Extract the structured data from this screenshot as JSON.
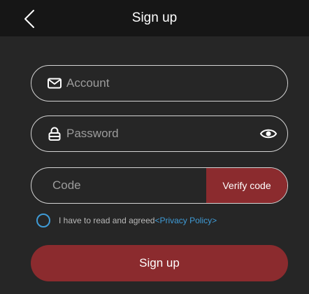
{
  "header": {
    "title": "Sign up",
    "back_icon": "chevron-left-icon"
  },
  "form": {
    "account": {
      "placeholder": "Account",
      "value": "",
      "icon": "mail-icon"
    },
    "password": {
      "placeholder": "Password",
      "value": "",
      "icon": "lock-icon",
      "toggle_icon": "eye-icon"
    },
    "code": {
      "placeholder": "Code",
      "value": "",
      "verify_label": "Verify code"
    }
  },
  "agreement": {
    "checked": false,
    "text": "I have to read and agreed",
    "link": "<Privacy Policy>"
  },
  "submit_label": "Sign up",
  "colors": {
    "background": "#262626",
    "header": "#161616",
    "accent": "#8b2b2e",
    "link": "#3f9bd6",
    "border": "#d4d4d4"
  }
}
